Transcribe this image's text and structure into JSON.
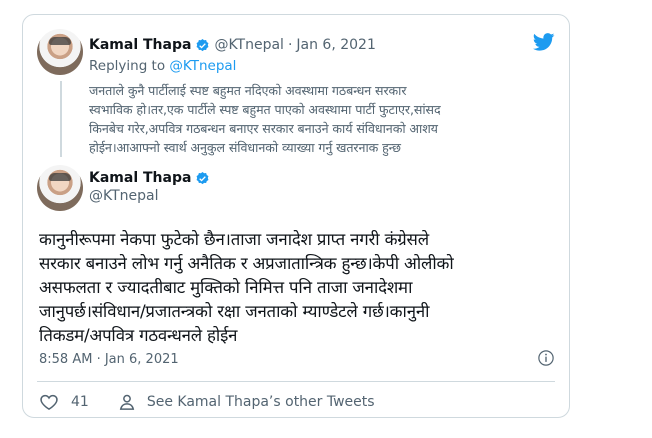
{
  "quoted_tweet": {
    "author_name": "Kamal Thapa",
    "author_handle": "@KTnepal",
    "date": "Jan 6, 2021",
    "replying_prefix": "Replying to ",
    "replying_handle": "@KTnepal",
    "text_lines": [
      "जनताले कुनै पार्टीलाई स्पष्ट बहुमत नदिएको अवस्थामा गठबन्धन सरकार",
      "स्वभाविक हो।तर,एक पार्टीले स्पष्ट बहुमत पाएको अवस्थामा पार्टी फुटाएर,सांसद",
      "किनबेच गरेर,अपवित्र गठबन्धन बनाएर सरकार बनाउने कार्य संविधानको आशय",
      "होईन।आआफ्नो स्वार्थ अनुकुल संविधानको व्याख्या गर्नु खतरनाक हुन्छ"
    ]
  },
  "main_tweet": {
    "author_name": "Kamal Thapa",
    "author_handle": "@KTnepal",
    "text_lines": [
      "कानुनीरूपमा नेकपा फुटेको छैन।ताजा जनादेश प्राप्त नगरी कंग्रेसले",
      "सरकार बनाउने लोभ गर्नु अनैतिक र अप्रजातान्त्रिक हुन्छ।केपी ओलीको",
      "असफलता र ज्यादतीबाट मुक्तिको निमित्त पनि ताजा जनादेशमा",
      "जानुपर्छ।संविधान/प्रजातन्त्रको रक्षा जनताको म्याण्डेटले गर्छ।कानुनी",
      "तिकडम/अपवित्र गठवन्धनले होईन"
    ],
    "time": "8:58 AM",
    "separator": " · ",
    "date": "Jan 6, 2021"
  },
  "actions": {
    "like_count": "41",
    "other_tweets_label": "See Kamal Thapa’s other Tweets"
  },
  "icons": {
    "verified": "verified-badge-icon",
    "brand": "twitter-bird-icon",
    "info": "info-icon",
    "like": "heart-icon",
    "profile": "person-icon"
  },
  "colors": {
    "brand_blue": "#1d9bf0",
    "text_primary": "#0f1419",
    "text_secondary": "#536471",
    "border": "#cfd9de"
  }
}
